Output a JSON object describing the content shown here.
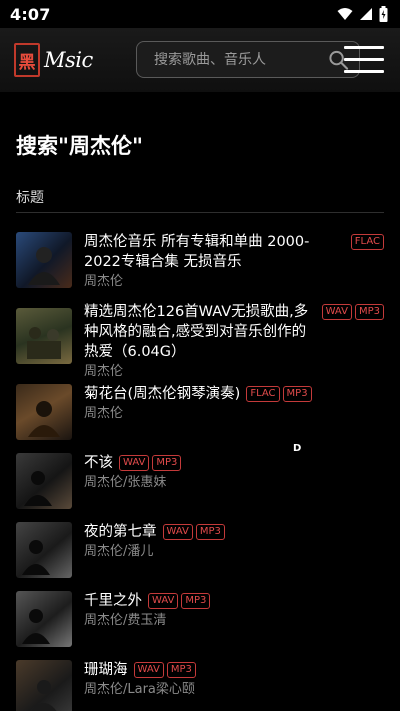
{
  "status_bar": {
    "time": "4:07",
    "icons": [
      "wifi-icon",
      "signal-icon",
      "battery-icon"
    ]
  },
  "header": {
    "logo": {
      "seal_text": "黑",
      "text": "Msic"
    },
    "search": {
      "placeholder": "搜索歌曲、音乐人",
      "value": ""
    },
    "menu_icon": "hamburger-menu-icon"
  },
  "search_heading": "搜索\"周杰伦\"",
  "section_label": "标题",
  "colors": {
    "accent": "#e14b4b",
    "background": "#000000",
    "secondary_text": "#8a8a8a"
  },
  "songs": [
    {
      "title": "周杰伦音乐 所有专辑和单曲 2000-2022专辑合集 无损音乐",
      "artist": "周杰伦",
      "badges": [
        "FLAC"
      ]
    },
    {
      "title": "精选周杰伦126首WAV无损歌曲,多种风格的融合,感受到对音乐创作的热爱（6.04G）",
      "artist": "周杰伦",
      "badges": [
        "WAV",
        "MP3"
      ]
    },
    {
      "title": "菊花台(周杰伦钢琴演奏)",
      "artist": "周杰伦",
      "badges": [
        "FLAC",
        "MP3"
      ]
    },
    {
      "title": "不该",
      "artist": "周杰伦/张惠妹",
      "badges": [
        "WAV",
        "MP3"
      ]
    },
    {
      "title": "夜的第七章",
      "artist": "周杰伦/潘儿",
      "badges": [
        "WAV",
        "MP3"
      ]
    },
    {
      "title": "千里之外",
      "artist": "周杰伦/费玉清",
      "badges": [
        "WAV",
        "MP3"
      ]
    },
    {
      "title": "珊瑚海",
      "artist": "周杰伦/Lara梁心颐",
      "badges": [
        "WAV",
        "MP3"
      ]
    }
  ],
  "cursor_mark": "D"
}
